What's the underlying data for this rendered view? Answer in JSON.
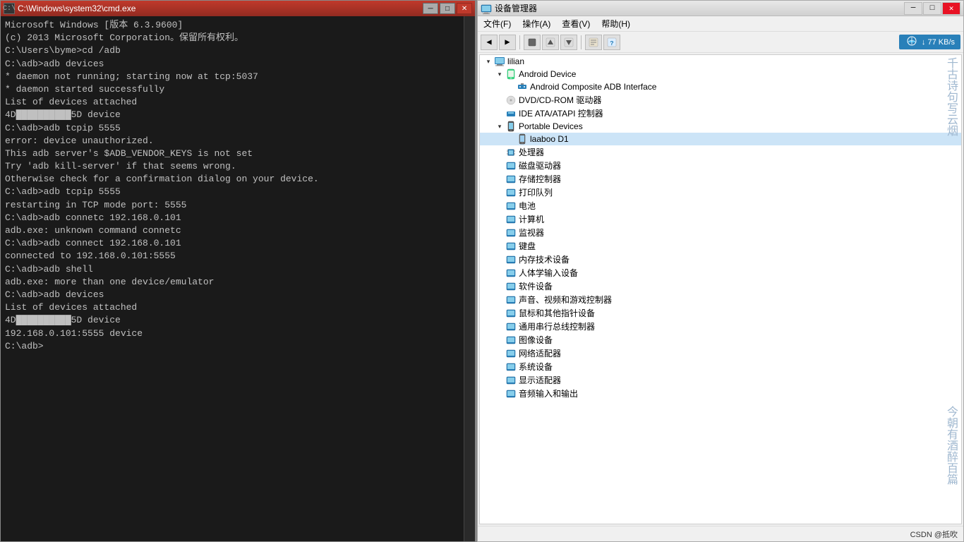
{
  "cmd": {
    "title": "C:\\Windows\\system32\\cmd.exe",
    "icon": "▶",
    "controls": {
      "minimize": "─",
      "maximize": "□",
      "close": "✕"
    },
    "content": [
      "Microsoft Windows [版本 6.3.9600]",
      "(c) 2013 Microsoft Corporation。保留所有权利。",
      "",
      "C:\\Users\\byme>cd /adb",
      "",
      "C:\\adb>adb devices",
      "* daemon not running; starting now at tcp:5037",
      "* daemon started successfully",
      "List of devices attached",
      "4D██████████5D          device",
      "",
      "",
      "C:\\adb>adb tcpip 5555",
      "error: device unauthorized.",
      "This adb server's $ADB_VENDOR_KEYS is not set",
      "Try 'adb kill-server' if that seems wrong.",
      "Otherwise check for a confirmation dialog on your device.",
      "",
      "",
      "C:\\adb>adb tcpip 5555",
      "restarting in TCP mode port: 5555",
      "",
      "",
      "C:\\adb>adb connetc 192.168.0.101",
      "adb.exe: unknown command connetc",
      "",
      "",
      "C:\\adb>adb connect 192.168.0.101",
      "connected to 192.168.0.101:5555",
      "",
      "",
      "C:\\adb>adb shell",
      "adb.exe: more than one device/emulator",
      "",
      "",
      "C:\\adb>adb devices",
      "List of devices attached",
      "4D██████████5D          device",
      "192.168.0.101:5555      device",
      "",
      "",
      "C:\\adb>"
    ]
  },
  "devmgr": {
    "title": "设备管理器",
    "icon": "⚙",
    "controls": {
      "minimize": "─",
      "maximize": "□",
      "close": "✕"
    },
    "menu": {
      "items": [
        "文件(F)",
        "操作(A)",
        "查看(V)",
        "帮助(H)"
      ]
    },
    "toolbar": {
      "buttons": [
        "◀",
        "▶",
        "■",
        "↑",
        "↓",
        "⟳"
      ],
      "net_speed": "↓ 77 KB/s"
    },
    "tree": {
      "root": {
        "label": "lilian",
        "icon": "🖥",
        "expanded": true,
        "children": [
          {
            "label": "Android Device",
            "icon": "📱",
            "expanded": true,
            "children": [
              {
                "label": "Android Composite ADB Interface",
                "icon": "🔌",
                "expanded": false,
                "children": []
              }
            ]
          },
          {
            "label": "DVD/CD-ROM 驱动器",
            "icon": "💿",
            "expanded": false,
            "children": []
          },
          {
            "label": "IDE ATA/ATAPI 控制器",
            "icon": "🖥",
            "expanded": false,
            "children": []
          },
          {
            "label": "Portable Devices",
            "icon": "📱",
            "expanded": true,
            "children": [
              {
                "label": "laaboo D1",
                "icon": "📱",
                "expanded": false,
                "children": []
              }
            ]
          },
          {
            "label": "处理器",
            "icon": "⚙",
            "expanded": false,
            "children": []
          },
          {
            "label": "磁盘驱动器",
            "icon": "💾",
            "expanded": false,
            "children": []
          },
          {
            "label": "存储控制器",
            "icon": "🖥",
            "expanded": false,
            "children": []
          },
          {
            "label": "打印队列",
            "icon": "🖨",
            "expanded": false,
            "children": []
          },
          {
            "label": "电池",
            "icon": "🔋",
            "expanded": false,
            "children": []
          },
          {
            "label": "计算机",
            "icon": "🖥",
            "expanded": false,
            "children": []
          },
          {
            "label": "监视器",
            "icon": "🖥",
            "expanded": false,
            "children": []
          },
          {
            "label": "键盘",
            "icon": "⌨",
            "expanded": false,
            "children": []
          },
          {
            "label": "内存技术设备",
            "icon": "🖥",
            "expanded": false,
            "children": []
          },
          {
            "label": "人体学输入设备",
            "icon": "🖥",
            "expanded": false,
            "children": []
          },
          {
            "label": "软件设备",
            "icon": "🖥",
            "expanded": false,
            "children": []
          },
          {
            "label": "声音、视频和游戏控制器",
            "icon": "🔊",
            "expanded": false,
            "children": []
          },
          {
            "label": "鼠标和其他指针设备",
            "icon": "🖱",
            "expanded": false,
            "children": []
          },
          {
            "label": "通用串行总线控制器",
            "icon": "🔌",
            "expanded": false,
            "children": []
          },
          {
            "label": "图像设备",
            "icon": "📷",
            "expanded": false,
            "children": []
          },
          {
            "label": "网络适配器",
            "icon": "🌐",
            "expanded": false,
            "children": []
          },
          {
            "label": "系统设备",
            "icon": "⚙",
            "expanded": false,
            "children": []
          },
          {
            "label": "显示适配器",
            "icon": "🖥",
            "expanded": false,
            "children": []
          },
          {
            "label": "音频输入和输出",
            "icon": "🎵",
            "expanded": false,
            "children": []
          }
        ]
      }
    },
    "watermark1": "千古诗句写云烟",
    "watermark2": "今朝有酒醉百篇",
    "statusbar": "CSDN @抵吹"
  }
}
